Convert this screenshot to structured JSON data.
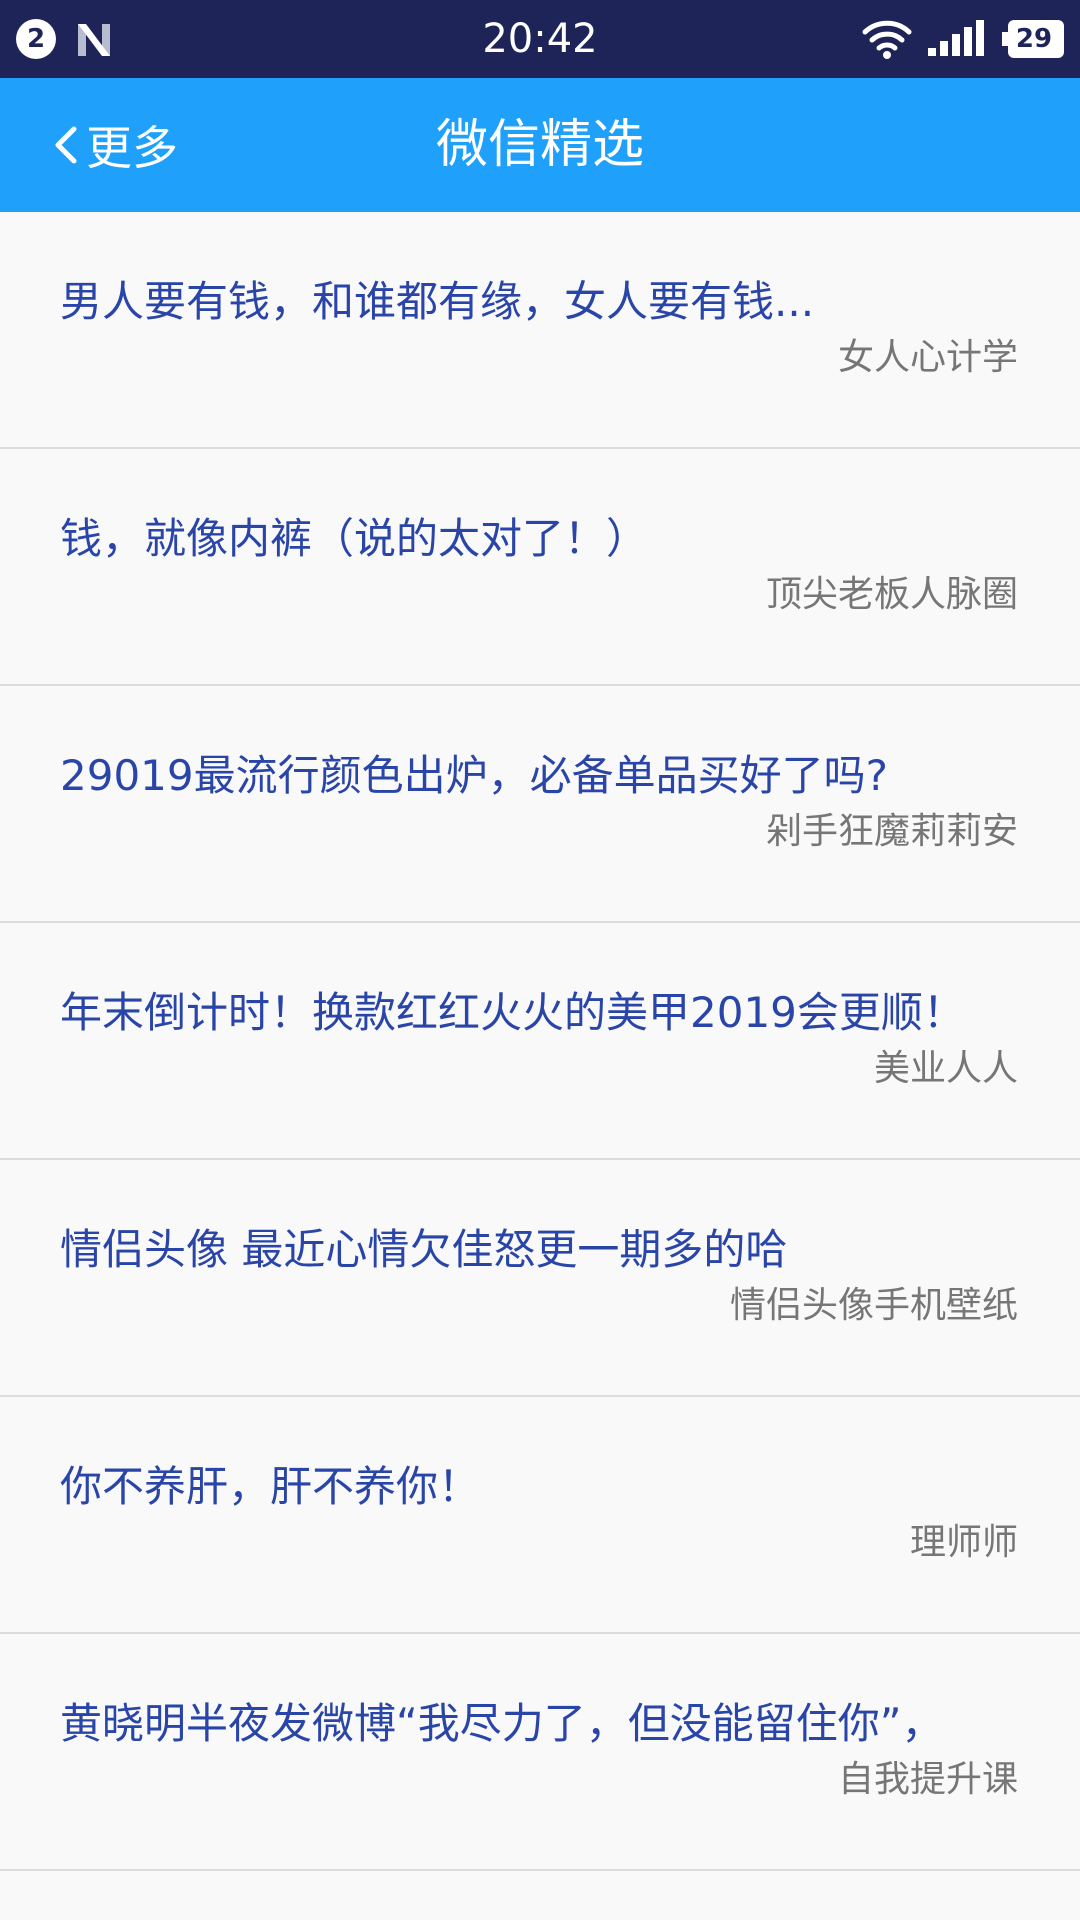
{
  "status_bar": {
    "notification_count": "2",
    "time": "20:42",
    "battery": "29",
    "icons": [
      "notification-badge-icon",
      "n-logo-icon",
      "wifi-icon",
      "signal-icon",
      "battery-icon"
    ]
  },
  "app_bar": {
    "back_label": "更多",
    "title": "微信精选",
    "background_color": "#1ea0fb"
  },
  "articles": [
    {
      "title": "男人要有钱，和谁都有缘，女人要有钱...",
      "source": "女人心计学"
    },
    {
      "title": "钱，就像内裤（说的太对了！）",
      "source": "顶尖老板人脉圈"
    },
    {
      "title": "29019最流行颜色出炉，必备单品买好了吗?",
      "source": "剁手狂魔莉莉安"
    },
    {
      "title": "年末倒计时！换款红红火火的美甲2019会更顺！",
      "source": "美业人人"
    },
    {
      "title": "情侣头像  最近心情欠佳怒更一期多的哈",
      "source": "情侣头像手机壁纸"
    },
    {
      "title": "你不养肝，肝不养你！",
      "source": "理师师"
    },
    {
      "title": "黄晓明半夜发微博“我尽力了，但没能留住你”，",
      "source": "自我提升课"
    }
  ],
  "colors": {
    "status_bar": "#1e2458",
    "title_text": "#2a45a8",
    "source_text": "#767676"
  }
}
